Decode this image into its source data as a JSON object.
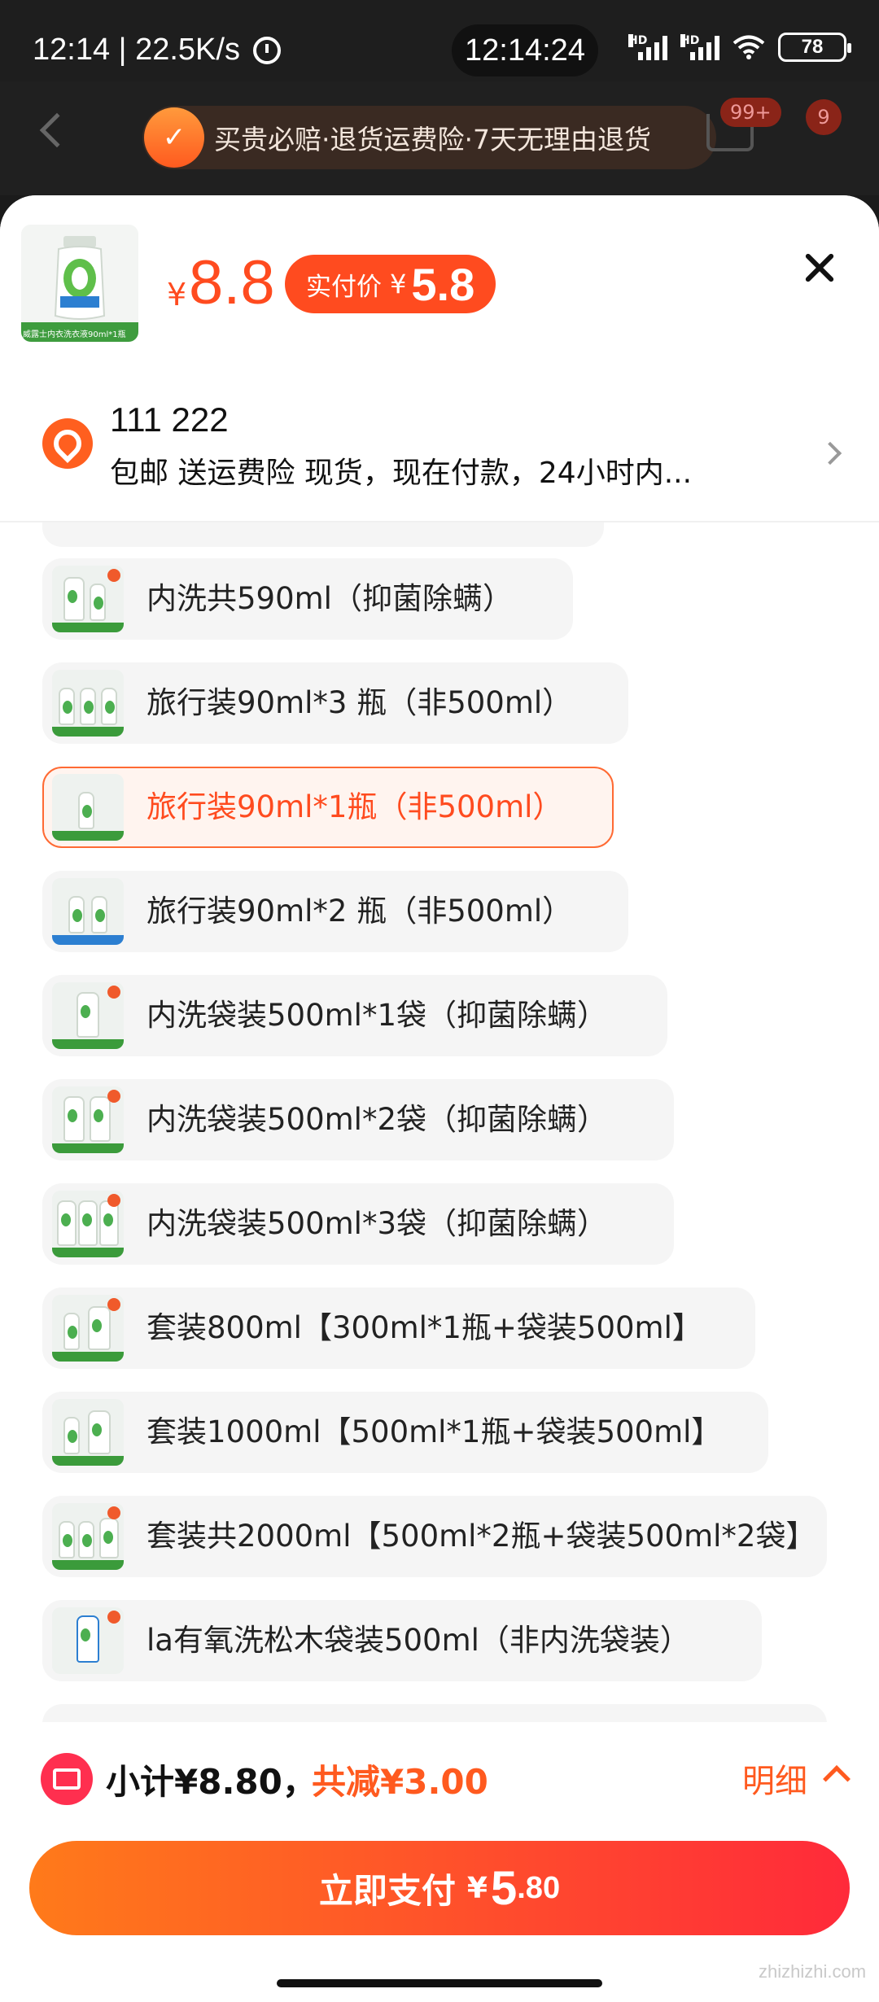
{
  "status_bar": {
    "left_text": "12:14 | 22.5K/s",
    "center_time": "12:14:24",
    "battery": "78"
  },
  "header": {
    "guarantee_text": "买贵必赔·退货运费险·7天无理由退货",
    "cart_badge": "99+",
    "message_badge": "9"
  },
  "product": {
    "thumb_caption": "威露士内衣洗衣液90ml*1瓶",
    "price_currency": "¥",
    "price": "8.8",
    "actual_label": "实付价",
    "actual_currency": "¥",
    "actual_price": "5.8"
  },
  "address": {
    "name": "111 222",
    "detail": "包邮 送运费险 现货，现在付款，24小时内..."
  },
  "options": [
    {
      "label": "内洗共590ml（抑菌除螨）",
      "selected": false
    },
    {
      "label": "旅行装90ml*3 瓶（非500ml）",
      "selected": false
    },
    {
      "label": "旅行装90ml*1瓶（非500ml）",
      "selected": true
    },
    {
      "label": "旅行装90ml*2 瓶（非500ml）",
      "selected": false
    },
    {
      "label": "内洗袋装500ml*1袋（抑菌除螨）",
      "selected": false
    },
    {
      "label": "内洗袋装500ml*2袋（抑菌除螨）",
      "selected": false
    },
    {
      "label": "内洗袋装500ml*3袋（抑菌除螨）",
      "selected": false
    },
    {
      "label": "套装800ml【300ml*1瓶+袋装500ml】",
      "selected": false
    },
    {
      "label": "套装1000ml【500ml*1瓶+袋装500ml】",
      "selected": false
    },
    {
      "label": "套装共2000ml【500ml*2瓶+袋装500ml*2袋】",
      "selected": false
    },
    {
      "label": "la有氧洗松木袋装500ml（非内洗袋装）",
      "selected": false
    }
  ],
  "footer": {
    "subtotal": "小计¥8.80，",
    "discount": "共减¥3.00",
    "detail_link": "明细",
    "pay_label": "立即支付",
    "pay_currency": "¥",
    "pay_int": "5",
    "pay_dec": ".80"
  },
  "watermark": "zhizhizhi.com",
  "colors": {
    "accent": "#ff4b1f",
    "pay_gradient_start": "#ff7a1a",
    "pay_gradient_end": "#ff2a3a"
  }
}
